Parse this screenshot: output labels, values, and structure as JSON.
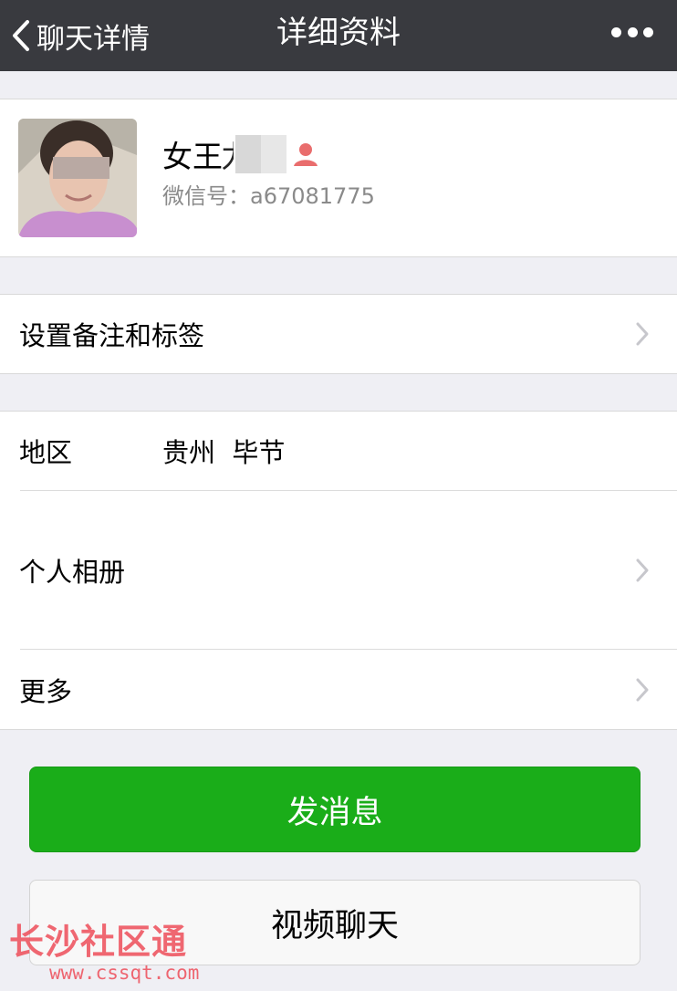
{
  "navbar": {
    "back_label": "聊天详情",
    "title": "详细资料",
    "more_icon": "more-dots-icon"
  },
  "profile": {
    "name_visible": "女王",
    "name_partial_char": "力",
    "wechat_id_label": "微信号：",
    "wechat_id": "a67081775",
    "gender_icon": "female-user-icon",
    "gender_color": "#e96d6d"
  },
  "remark": {
    "label": "设置备注和标签"
  },
  "details": {
    "region_label": "地区",
    "region_value": "贵州  毕节",
    "album_label": "个人相册",
    "more_label": "更多"
  },
  "actions": {
    "send_message": "发消息",
    "video_call": "视频聊天",
    "primary_color": "#1aad19"
  },
  "watermark": {
    "title": "长沙社区通",
    "url": "www.cssqt.com"
  }
}
